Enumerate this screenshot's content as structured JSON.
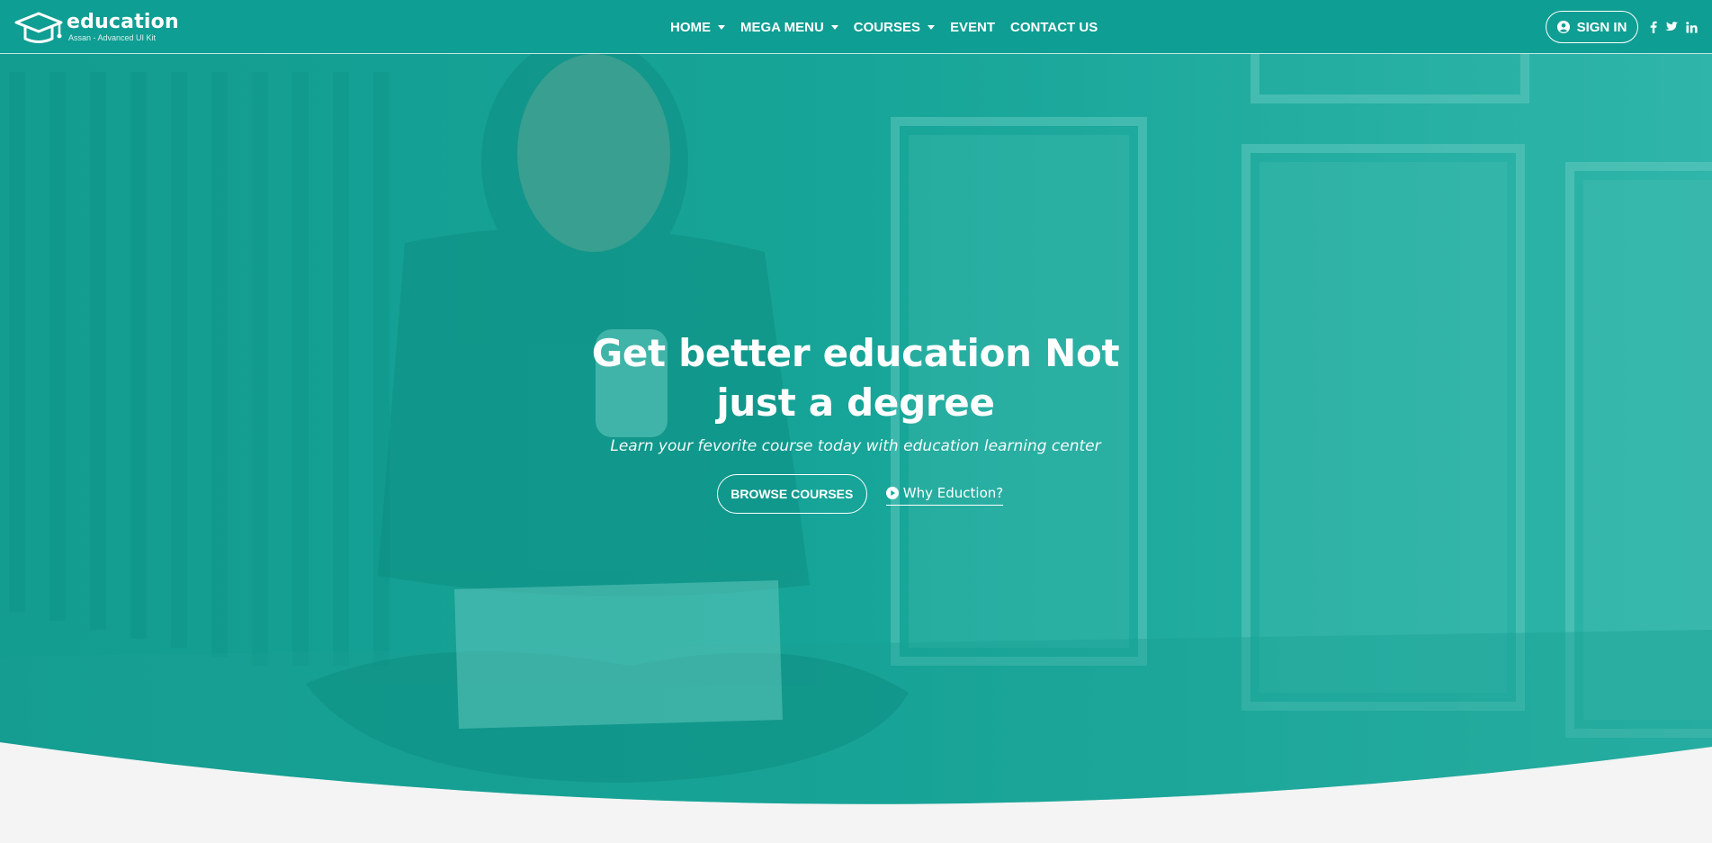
{
  "brand": {
    "name": "education",
    "tagline": "Assan - Advanced UI Kit",
    "icon": "graduation-cap-icon"
  },
  "nav": {
    "items": [
      {
        "label": "HOME",
        "dropdown": true
      },
      {
        "label": "MEGA MENU",
        "dropdown": true
      },
      {
        "label": "COURSES",
        "dropdown": true
      },
      {
        "label": "EVENT",
        "dropdown": false
      },
      {
        "label": "CONTACT US",
        "dropdown": false
      }
    ],
    "signin_label": "SIGN IN",
    "signin_icon": "user-circle-icon",
    "socials": [
      {
        "label": "f",
        "icon": "facebook-icon"
      },
      {
        "label": "twitter",
        "icon": "twitter-icon"
      },
      {
        "label": "in",
        "icon": "linkedin-icon"
      }
    ]
  },
  "hero": {
    "title_line1": "Get better education Not",
    "title_line2": "just a degree",
    "subtitle": "Learn your fevorite course today with education learning center",
    "browse_label": "BROWSE COURSES",
    "why_label": "Why Eduction?",
    "why_icon": "play-circle-icon"
  },
  "colors": {
    "nav_bg": "#0f9e93",
    "hero_overlay": "#12a79a",
    "page_bg": "#f4f4f4",
    "text": "#ffffff"
  }
}
